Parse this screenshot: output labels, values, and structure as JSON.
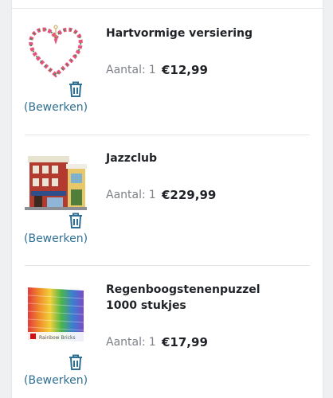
{
  "colors": {
    "accent": "#2e6f93",
    "text": "#1f2226",
    "muted": "#7d8187",
    "divider": "#e3e5e8"
  },
  "items": [
    {
      "name": "Hartvormige versiering",
      "quantity_label": "Aantal:",
      "quantity": "1",
      "price": "€12,99",
      "edit_label": "(Bewerken)",
      "image_icon": "heart-wreath-product-icon"
    },
    {
      "name": "Jazzclub",
      "quantity_label": "Aantal:",
      "quantity": "1",
      "price": "€229,99",
      "edit_label": "(Bewerken)",
      "image_icon": "jazzclub-building-product-icon"
    },
    {
      "name": "Regenboogstenenpuzzel\n1000 stukjes",
      "quantity_label": "Aantal:",
      "quantity": "1",
      "price": "€17,99",
      "edit_label": "(Bewerken)",
      "image_icon": "rainbow-bricks-puzzle-product-icon",
      "box_text": "Rainbow Bricks"
    }
  ]
}
